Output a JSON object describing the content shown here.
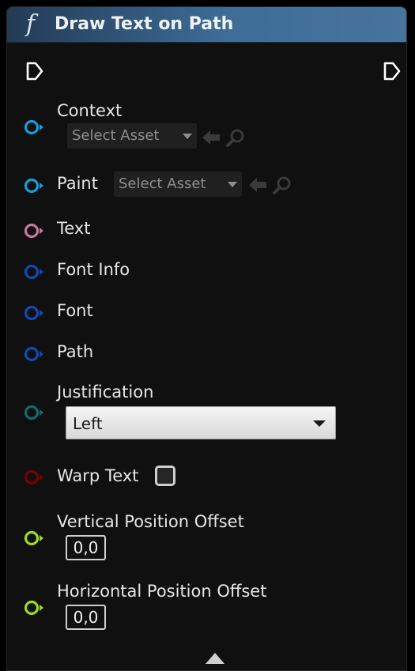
{
  "node": {
    "title": "Draw Text on Path",
    "function_symbol": "f"
  },
  "pins": {
    "context": {
      "label": "Context",
      "asset_placeholder": "Select Asset",
      "color": "#1a9bd7"
    },
    "paint": {
      "label": "Paint",
      "asset_placeholder": "Select Asset",
      "color": "#1a9bd7"
    },
    "text": {
      "label": "Text",
      "color": "#c9799a"
    },
    "font_info": {
      "label": "Font Info",
      "color": "#1149b5"
    },
    "font": {
      "label": "Font",
      "color": "#1149b5"
    },
    "path": {
      "label": "Path",
      "color": "#1149b5"
    },
    "justification": {
      "label": "Justification",
      "value": "Left",
      "color": "#126b6b"
    },
    "warp_text": {
      "label": "Warp Text",
      "checked": false,
      "color": "#7a0000"
    },
    "vertical_offset": {
      "label": "Vertical Position Offset",
      "value": "0,0",
      "color": "#9adb27"
    },
    "horizontal_offset": {
      "label": "Horizontal Position Offset",
      "value": "0,0",
      "color": "#9adb27"
    }
  },
  "colors": {
    "header_start": "#233a55",
    "header_end": "#47749c",
    "node_body": "#101010"
  },
  "icons": {
    "exec_in": "exec-pin-icon",
    "exec_out": "exec-pin-icon",
    "use_selected": "arrow-left-icon",
    "browse": "magnifier-icon",
    "collapse": "triangle-up-icon"
  }
}
